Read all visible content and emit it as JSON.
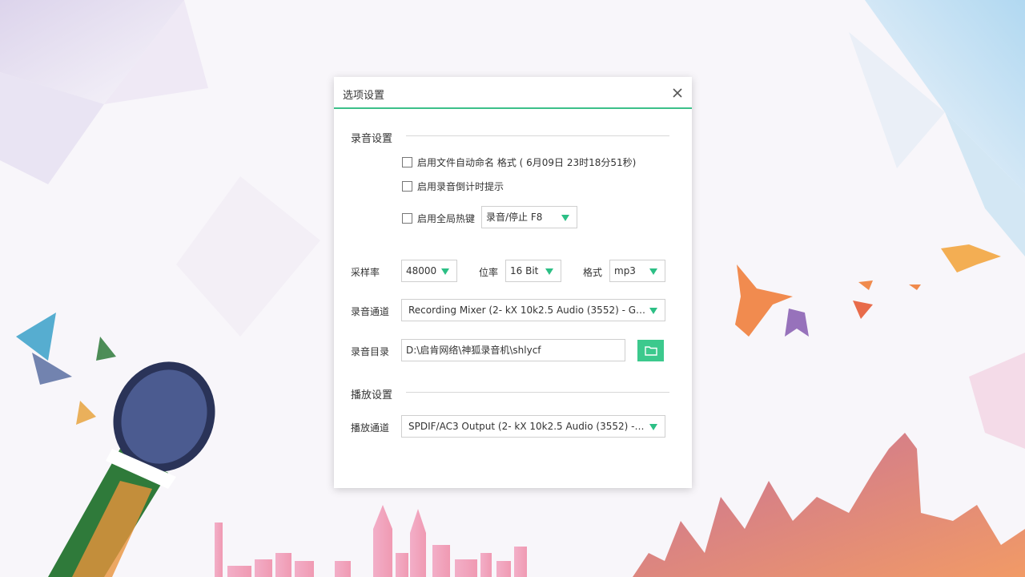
{
  "dialog": {
    "title": "选项设置",
    "close_icon": "close-icon"
  },
  "recording": {
    "section_title": "录音设置",
    "auto_name_label": "启用文件自动命名 格式 ( 6月09日 23时18分51秒)",
    "auto_name_checked": false,
    "countdown_label": "启用录音倒计时提示",
    "countdown_checked": false,
    "hotkey_label": "启用全局热键",
    "hotkey_checked": false,
    "hotkey_value": "录音/停止 F8",
    "sample_rate_label": "采样率",
    "sample_rate_value": "48000",
    "bit_depth_label": "位率",
    "bit_depth_value": "16 Bit",
    "format_label": "格式",
    "format_value": "mp3",
    "channel_label": "录音通道",
    "channel_value": "Recording Mixer (2- kX 10k2.5 Audio (3552) - Gen...",
    "dir_label": "录音目录",
    "dir_value": "D:\\启肯网络\\神狐录音机\\shlycf",
    "browse_icon": "folder-icon"
  },
  "playback": {
    "section_title": "播放设置",
    "channel_label": "播放通道",
    "channel_value": "SPDIF/AC3 Output (2- kX 10k2.5 Audio (3552) - G..."
  },
  "colors": {
    "accent": "#3cc08a",
    "arrow": "#2cbf85"
  }
}
